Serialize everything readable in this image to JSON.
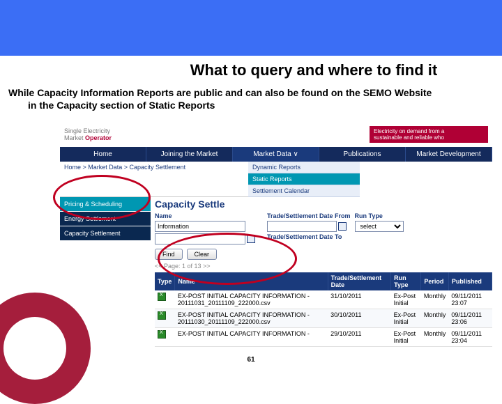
{
  "slide": {
    "title": "What to query and where to find it",
    "body_line1": "While Capacity Information Reports are public and can also be found on the SEMO Website",
    "body_line2": "in the Capacity section of Static Reports",
    "page_number": "61"
  },
  "logo": {
    "line1": "Single Electricity",
    "line2_prefix": "Market ",
    "line2_bold": "Operator"
  },
  "red_tag": {
    "line1": "Electricity on demand from a",
    "line2": "sustainable and reliable who"
  },
  "nav": {
    "home": "Home",
    "joining": "Joining the Market",
    "market_data": "Market Data",
    "chevron": "∨",
    "publications": "Publications",
    "market_dev": "Market Development"
  },
  "breadcrumb": "Home > Market Data > Capacity Settlement",
  "submenu": {
    "dynamic": "Dynamic Reports",
    "static": "Static Reports",
    "calendar": "Settlement Calendar"
  },
  "sidebar": {
    "pricing": "Pricing & Scheduling",
    "energy": "Energy Settlement",
    "capacity": "Capacity Settlement"
  },
  "page_head": "Capacity Settle",
  "filters": {
    "name_label": "Name",
    "name_value": "Information",
    "date_from_label": "Trade/Settlement Date From",
    "date_to_label": "Trade/Settlement Date To",
    "run_type_label": "Run Type",
    "run_type_value": "select"
  },
  "buttons": {
    "find": "Find",
    "clear": "Clear"
  },
  "pager": "<< Page: 1 of 13 >>",
  "table": {
    "headers": {
      "type": "Type",
      "name": "Name",
      "date": "Trade/Settlement Date",
      "run": "Run Type",
      "period": "Period",
      "published": "Published"
    },
    "rows": [
      {
        "name": "EX-POST INITIAL CAPACITY INFORMATION - 20111031_20111109_222000.csv",
        "date": "31/10/2011",
        "run": "Ex-Post Initial",
        "period": "Monthly",
        "published": "09/11/2011 23:07"
      },
      {
        "name": "EX-POST INITIAL CAPACITY INFORMATION - 20111030_20111109_222000.csv",
        "date": "30/10/2011",
        "run": "Ex-Post Initial",
        "period": "Monthly",
        "published": "09/11/2011 23:06"
      },
      {
        "name": "EX-POST INITIAL CAPACITY INFORMATION -",
        "date": "29/10/2011",
        "run": "Ex-Post Initial",
        "period": "Monthly",
        "published": "09/11/2011 23:04"
      }
    ]
  }
}
